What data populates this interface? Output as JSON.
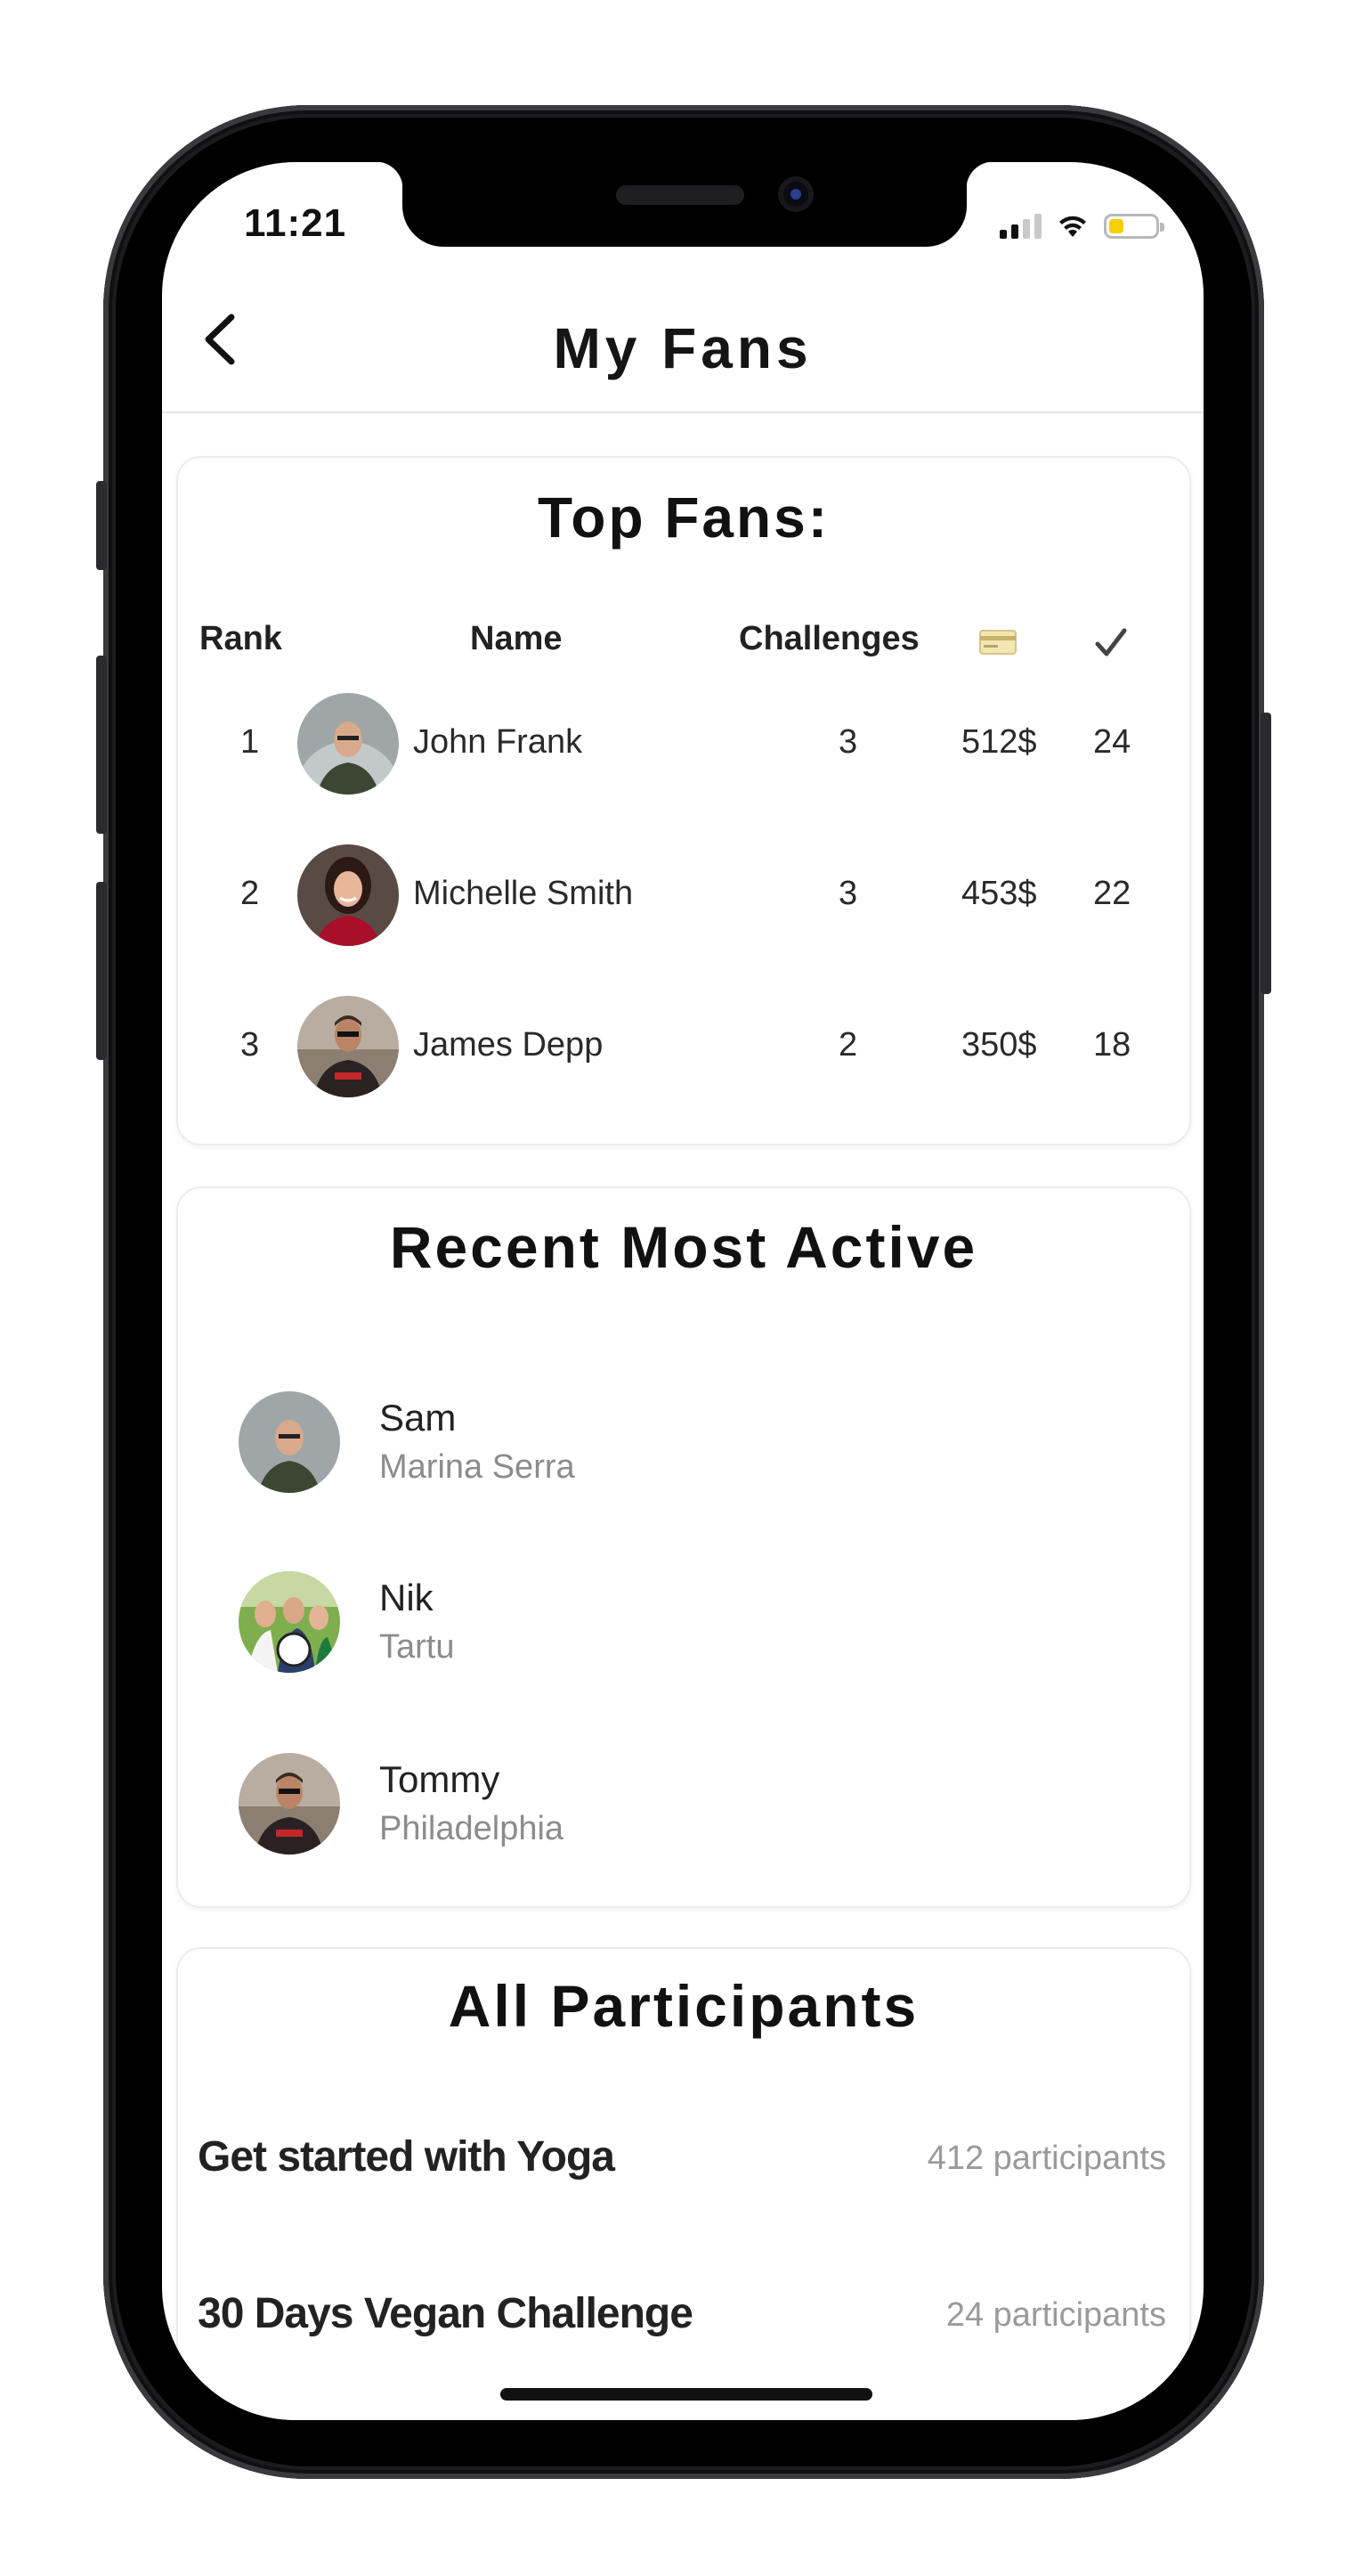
{
  "status_bar": {
    "time": "11:21"
  },
  "nav": {
    "title": "My Fans"
  },
  "top_fans": {
    "title": "Top Fans:",
    "headers": {
      "rank": "Rank",
      "name": "Name",
      "challenges": "Challenges"
    },
    "rows": [
      {
        "rank": "1",
        "name": "John Frank",
        "challenges": "3",
        "amount": "512$",
        "checks": "24"
      },
      {
        "rank": "2",
        "name": "Michelle Smith",
        "challenges": "3",
        "amount": "453$",
        "checks": "22"
      },
      {
        "rank": "3",
        "name": "James Depp",
        "challenges": "2",
        "amount": "350$",
        "checks": "18"
      }
    ]
  },
  "recent": {
    "title": "Recent Most Active",
    "items": [
      {
        "name": "Sam",
        "location": "Marina Serra"
      },
      {
        "name": "Nik",
        "location": "Tartu"
      },
      {
        "name": "Tommy",
        "location": "Philadelphia"
      }
    ]
  },
  "participants": {
    "title": "All Participants",
    "items": [
      {
        "name": "Get started with Yoga",
        "count": "412 participants"
      },
      {
        "name": "30 Days Vegan Challenge",
        "count": "24 participants"
      }
    ]
  },
  "icons": {
    "payment_header": "credit-card-icon",
    "check_header": "checkmark-icon",
    "back": "chevron-left-icon"
  },
  "colors": {
    "battery": "#f5cf00",
    "text_primary": "#222222",
    "text_secondary": "#8c8c8c"
  }
}
